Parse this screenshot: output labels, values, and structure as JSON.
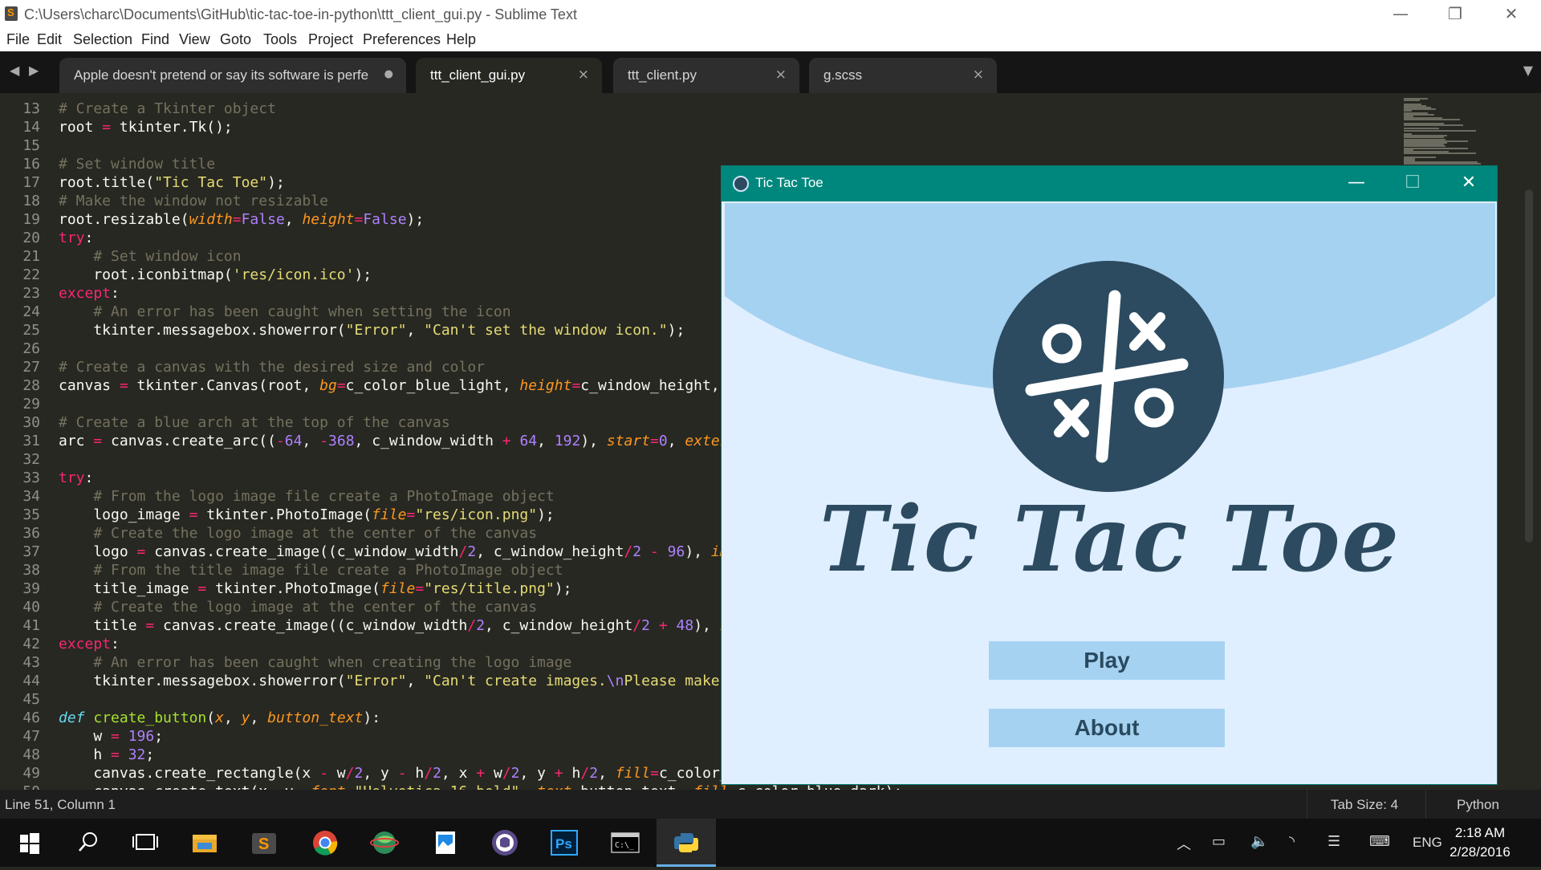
{
  "window": {
    "title": "C:\\Users\\charc\\Documents\\GitHub\\tic-tac-toe-in-python\\ttt_client_gui.py - Sublime Text",
    "minimize_glyph": "—",
    "restore_glyph": "❐",
    "close_glyph": "✕"
  },
  "menu": [
    "File",
    "Edit",
    "Selection",
    "Find",
    "View",
    "Goto",
    "Tools",
    "Project",
    "Preferences",
    "Help"
  ],
  "tabs": [
    {
      "label": "Apple doesn't pretend or say its software is perfe",
      "close": "●"
    },
    {
      "label": "ttt_client_gui.py",
      "close": "×"
    },
    {
      "label": "ttt_client.py",
      "close": "×"
    },
    {
      "label": "g.scss",
      "close": "×"
    }
  ],
  "line_numbers": [
    "13",
    "14",
    "15",
    "16",
    "17",
    "18",
    "19",
    "20",
    "21",
    "22",
    "23",
    "24",
    "25",
    "26",
    "27",
    "28",
    "29",
    "30",
    "31",
    "32",
    "33",
    "34",
    "35",
    "36",
    "37",
    "38",
    "39",
    "40",
    "41",
    "42",
    "43",
    "44",
    "45",
    "46",
    "47",
    "48",
    "49",
    "50"
  ],
  "code_lines": [
    [
      [
        "cm",
        "# Create a Tkinter object"
      ]
    ],
    [
      [
        "",
        "root "
      ],
      [
        "kw",
        "="
      ],
      [
        "",
        " tkinter.Tk();"
      ]
    ],
    [],
    [
      [
        "cm",
        "# Set window title"
      ]
    ],
    [
      [
        "",
        "root.title("
      ],
      [
        "st",
        "\"Tic Tac Toe\""
      ],
      [
        "",
        ");"
      ]
    ],
    [
      [
        "cm",
        "# Make the window not resizable"
      ]
    ],
    [
      [
        "",
        "root.resizable("
      ],
      [
        "pa",
        "width"
      ],
      [
        "kw",
        "="
      ],
      [
        "nu",
        "False"
      ],
      [
        "",
        ", "
      ],
      [
        "pa",
        "height"
      ],
      [
        "kw",
        "="
      ],
      [
        "nu",
        "False"
      ],
      [
        "",
        ");"
      ]
    ],
    [
      [
        "kw",
        "try"
      ],
      [
        "",
        ":"
      ]
    ],
    [
      [
        "",
        "    "
      ],
      [
        "cm",
        "# Set window icon"
      ]
    ],
    [
      [
        "",
        "    root.iconbitmap("
      ],
      [
        "st",
        "'res/icon.ico'"
      ],
      [
        "",
        ");"
      ]
    ],
    [
      [
        "kw",
        "except"
      ],
      [
        "",
        ":"
      ]
    ],
    [
      [
        "",
        "    "
      ],
      [
        "cm",
        "# An error has been caught when setting the icon"
      ]
    ],
    [
      [
        "",
        "    tkinter.messagebox.showerror("
      ],
      [
        "st",
        "\"Error\""
      ],
      [
        "",
        ", "
      ],
      [
        "st",
        "\"Can't set the window icon.\""
      ],
      [
        "",
        ");"
      ]
    ],
    [],
    [
      [
        "cm",
        "# Create a canvas with the desired size and color"
      ]
    ],
    [
      [
        "",
        "canvas "
      ],
      [
        "kw",
        "="
      ],
      [
        "",
        " tkinter.Canvas(root, "
      ],
      [
        "pa",
        "bg"
      ],
      [
        "kw",
        "="
      ],
      [
        "",
        "c_color_blue_light, "
      ],
      [
        "pa",
        "height"
      ],
      [
        "kw",
        "="
      ],
      [
        "",
        "c_window_height,"
      ]
    ],
    [],
    [
      [
        "cm",
        "# Create a blue arch at the top of the canvas"
      ]
    ],
    [
      [
        "",
        "arc "
      ],
      [
        "kw",
        "="
      ],
      [
        "",
        " canvas.create_arc(("
      ],
      [
        "kw",
        "-"
      ],
      [
        "nu",
        "64"
      ],
      [
        "",
        ", "
      ],
      [
        "kw",
        "-"
      ],
      [
        "nu",
        "368"
      ],
      [
        "",
        ", c_window_width "
      ],
      [
        "kw",
        "+"
      ],
      [
        "",
        " "
      ],
      [
        "nu",
        "64"
      ],
      [
        "",
        ", "
      ],
      [
        "nu",
        "192"
      ],
      [
        "",
        "), "
      ],
      [
        "pa",
        "start"
      ],
      [
        "kw",
        "="
      ],
      [
        "nu",
        "0"
      ],
      [
        "",
        ", "
      ],
      [
        "pa",
        "exten"
      ]
    ],
    [],
    [
      [
        "kw",
        "try"
      ],
      [
        "",
        ":"
      ]
    ],
    [
      [
        "",
        "    "
      ],
      [
        "cm",
        "# From the logo image file create a PhotoImage object"
      ]
    ],
    [
      [
        "",
        "    logo_image "
      ],
      [
        "kw",
        "="
      ],
      [
        "",
        " tkinter.PhotoImage("
      ],
      [
        "pa",
        "file"
      ],
      [
        "kw",
        "="
      ],
      [
        "st",
        "\"res/icon.png\""
      ],
      [
        "",
        ");"
      ]
    ],
    [
      [
        "",
        "    "
      ],
      [
        "cm",
        "# Create the logo image at the center of the canvas"
      ]
    ],
    [
      [
        "",
        "    logo "
      ],
      [
        "kw",
        "="
      ],
      [
        "",
        " canvas.create_image((c_window_width"
      ],
      [
        "kw",
        "/"
      ],
      [
        "nu",
        "2"
      ],
      [
        "",
        ", c_window_height"
      ],
      [
        "kw",
        "/"
      ],
      [
        "nu",
        "2"
      ],
      [
        "",
        " "
      ],
      [
        "kw",
        "-"
      ],
      [
        "",
        " "
      ],
      [
        "nu",
        "96"
      ],
      [
        "",
        "), "
      ],
      [
        "pa",
        "im"
      ]
    ],
    [
      [
        "",
        "    "
      ],
      [
        "cm",
        "# From the title image file create a PhotoImage object"
      ]
    ],
    [
      [
        "",
        "    title_image "
      ],
      [
        "kw",
        "="
      ],
      [
        "",
        " tkinter.PhotoImage("
      ],
      [
        "pa",
        "file"
      ],
      [
        "kw",
        "="
      ],
      [
        "st",
        "\"res/title.png\""
      ],
      [
        "",
        ");"
      ]
    ],
    [
      [
        "",
        "    "
      ],
      [
        "cm",
        "# Create the logo image at the center of the canvas"
      ]
    ],
    [
      [
        "",
        "    title "
      ],
      [
        "kw",
        "="
      ],
      [
        "",
        " canvas.create_image((c_window_width"
      ],
      [
        "kw",
        "/"
      ],
      [
        "nu",
        "2"
      ],
      [
        "",
        ", c_window_height"
      ],
      [
        "kw",
        "/"
      ],
      [
        "nu",
        "2"
      ],
      [
        "",
        " "
      ],
      [
        "kw",
        "+"
      ],
      [
        "",
        " "
      ],
      [
        "nu",
        "48"
      ],
      [
        "",
        "), "
      ],
      [
        "pa",
        "i"
      ]
    ],
    [
      [
        "kw",
        "except"
      ],
      [
        "",
        ":"
      ]
    ],
    [
      [
        "",
        "    "
      ],
      [
        "cm",
        "# An error has been caught when creating the logo image"
      ]
    ],
    [
      [
        "",
        "    tkinter.messagebox.showerror("
      ],
      [
        "st",
        "\"Error\""
      ],
      [
        "",
        ", "
      ],
      [
        "st",
        "\"Can't create images."
      ],
      [
        "nu",
        "\\n"
      ],
      [
        "st",
        "Please make"
      ]
    ],
    [],
    [
      [
        "df",
        "def"
      ],
      [
        "",
        " "
      ],
      [
        "fn",
        "create_button"
      ],
      [
        "",
        "("
      ],
      [
        "pa",
        "x"
      ],
      [
        "",
        ", "
      ],
      [
        "pa",
        "y"
      ],
      [
        "",
        ", "
      ],
      [
        "pa",
        "button_text"
      ],
      [
        "",
        "):"
      ]
    ],
    [
      [
        "",
        "    w "
      ],
      [
        "kw",
        "="
      ],
      [
        "",
        " "
      ],
      [
        "nu",
        "196"
      ],
      [
        "",
        ";"
      ]
    ],
    [
      [
        "",
        "    h "
      ],
      [
        "kw",
        "="
      ],
      [
        "",
        " "
      ],
      [
        "nu",
        "32"
      ],
      [
        "",
        ";"
      ]
    ],
    [
      [
        "",
        "    canvas.create_rectangle(x "
      ],
      [
        "kw",
        "-"
      ],
      [
        "",
        " w"
      ],
      [
        "kw",
        "/"
      ],
      [
        "nu",
        "2"
      ],
      [
        "",
        ", y "
      ],
      [
        "kw",
        "-"
      ],
      [
        "",
        " h"
      ],
      [
        "kw",
        "/"
      ],
      [
        "nu",
        "2"
      ],
      [
        "",
        ", x "
      ],
      [
        "kw",
        "+"
      ],
      [
        "",
        " w"
      ],
      [
        "kw",
        "/"
      ],
      [
        "nu",
        "2"
      ],
      [
        "",
        ", y "
      ],
      [
        "kw",
        "+"
      ],
      [
        "",
        " h"
      ],
      [
        "kw",
        "/"
      ],
      [
        "nu",
        "2"
      ],
      [
        "",
        ", "
      ],
      [
        "pa",
        "fill"
      ],
      [
        "kw",
        "="
      ],
      [
        "",
        "c_color_"
      ]
    ],
    [
      [
        "",
        "    canvas.create_text(x, y, "
      ],
      [
        "pa",
        "font"
      ],
      [
        "kw",
        "="
      ],
      [
        "st",
        "\"Helvetica 16 bold\""
      ],
      [
        "",
        ", "
      ],
      [
        "pa",
        "text"
      ],
      [
        "kw",
        "="
      ],
      [
        "",
        "button_text, "
      ],
      [
        "pa",
        "fill"
      ],
      [
        "kw",
        "="
      ],
      [
        "",
        "c_color_blue_dark);"
      ]
    ]
  ],
  "status": {
    "position": "Line 51, Column 1",
    "tab_size": "Tab Size: 4",
    "syntax": "Python"
  },
  "game": {
    "title": "Tic Tac Toe",
    "logo_title": "Tic Tac Toe",
    "play_label": "Play",
    "about_label": "About",
    "colors": {
      "blue_light": "#e0efff",
      "blue": "#a6d2f1",
      "blue_dark": "#2c4b60",
      "titlebar": "#00877d"
    }
  },
  "taskbar": {
    "items": [
      "windows-start-icon",
      "search-icon",
      "task-view-icon",
      "file-explorer-icon",
      "sublime-text-icon",
      "chrome-icon",
      "maps-globe-icon",
      "photos-icon",
      "github-icon",
      "photoshop-icon",
      "command-prompt-icon",
      "python-icon"
    ],
    "tray_lang": "ENG",
    "time": "2:18 AM",
    "date": "2/28/2016"
  }
}
